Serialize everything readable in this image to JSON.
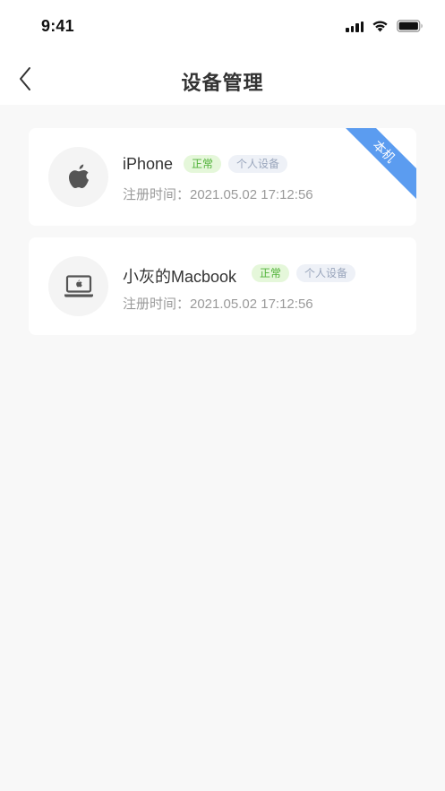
{
  "status_bar": {
    "time": "9:41"
  },
  "nav": {
    "title": "设备管理"
  },
  "devices": [
    {
      "name": "iPhone",
      "status_tag": "正常",
      "type_tag": "个人设备",
      "registered": "注册时间：2021.05.02 17:12:56",
      "icon": "apple-icon",
      "current_badge": "本机"
    },
    {
      "name": "小灰的Macbook",
      "status_tag": "正常",
      "type_tag": "个人设备",
      "registered": "注册时间：2021.05.02 17:12:56",
      "icon": "laptop-icon"
    }
  ],
  "colors": {
    "accent_blue": "#5b9cf0",
    "status_green": "#4fb238",
    "background": "#f8f8f8"
  }
}
